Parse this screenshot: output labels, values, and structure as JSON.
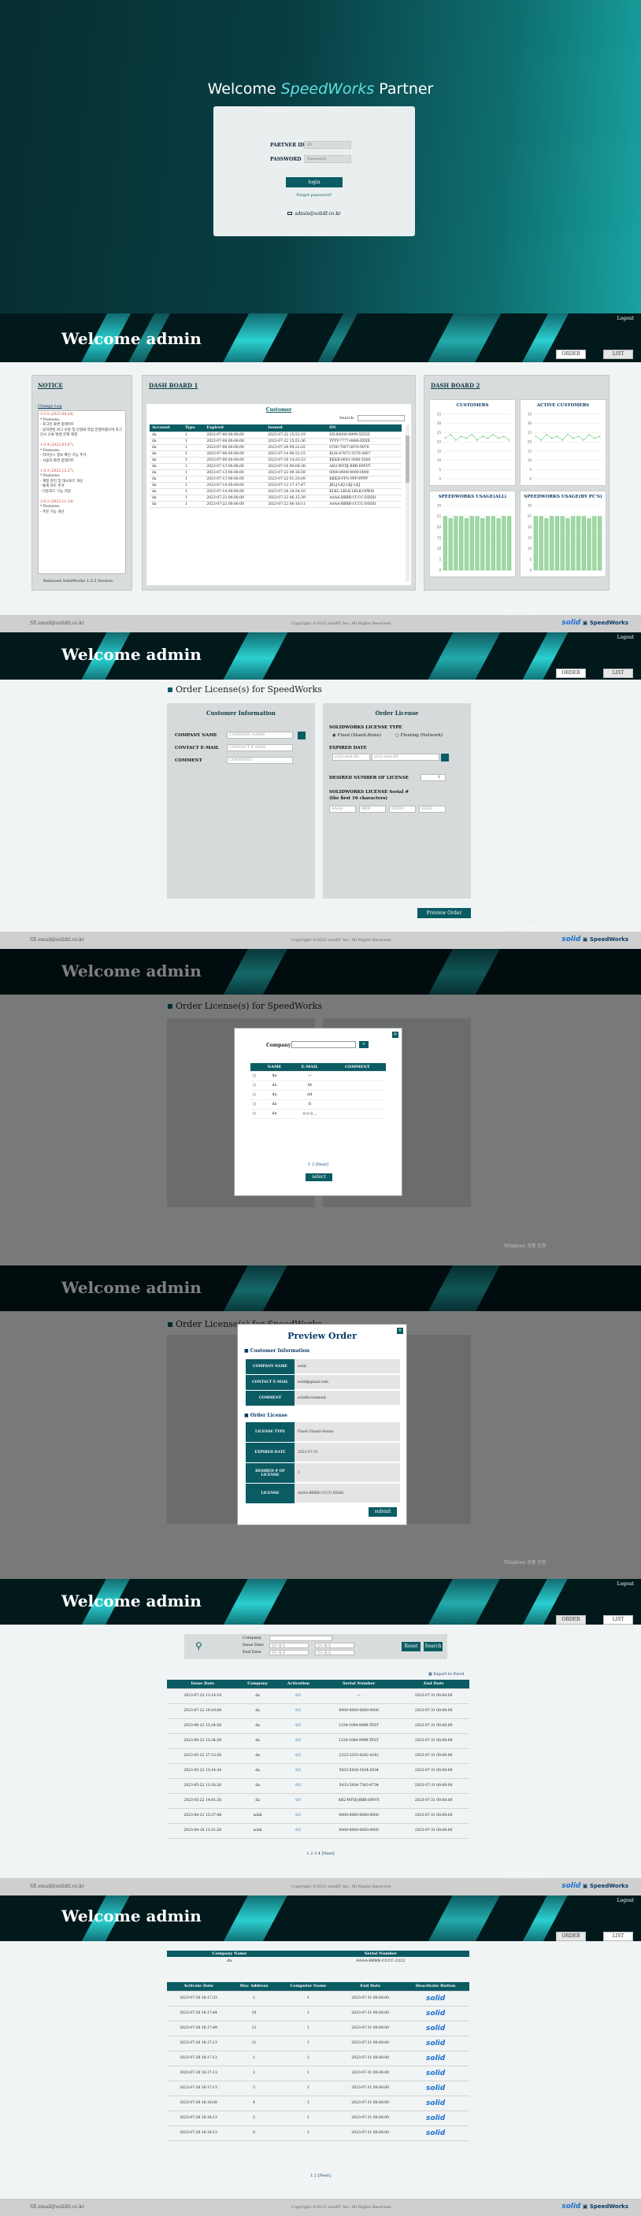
{
  "brand": {
    "accent": "#0b5b63",
    "teal_light": "#5ee0de"
  },
  "login": {
    "welcome_prefix": "Welcome ",
    "welcome_brand": "SpeedWorks",
    "welcome_suffix": " Partner",
    "partner_id_label": "PARTNER ID",
    "partner_id_value": "ID",
    "password_label": "PASSWORD",
    "password_placeholder": "Password",
    "login_button": "login",
    "forgot": "Forgot password?",
    "email_icon": "mail-icon",
    "email": "admin@solidf.co.kr"
  },
  "header": {
    "welcome": "Welcome admin",
    "logout": "Logout",
    "tab_order": "ORDER",
    "tab_list": "LIST"
  },
  "footer": {
    "email": "SE.email@solidit.co.kr",
    "copyright": "Copyright ©2022 solidIT Inc. All Rights Reserved.",
    "brand": "SpeedWorks",
    "logo": "solidit"
  },
  "windows_wm": {
    "line1": "Windows 정품 인증",
    "line2": "설정으로 이동하여 Windows를 정품 인증합니다."
  },
  "dashboard": {
    "notice": {
      "title": "NOTICE",
      "change_log": "Change Log",
      "lines": [
        "1.0.5 (2023.04.24)",
        "* Features:",
        "- 로그인 화면 업데이트",
        "- 동작관련 버그 수정 및 안정화 작업 진행하였으며 로그인시 오류 발생 문제 해결",
        "",
        "1.0.4 (2023.03.07)",
        "* Features:",
        "- 라이선스 정보 확인 기능 추가",
        "- 사용자 화면 업데이트",
        "",
        "1.0.3 (2022.12.27)",
        "* Features:",
        "- 계정 관리 및 대시보드 개선",
        "- 통계 차트 추가",
        "- 다운로드 기능 지원",
        "",
        "1.0.2 (2022.11.14)",
        "* Features:",
        "- 주문 기능 개선"
      ],
      "release": "Released SolidWorks 1.0.5 Version"
    },
    "board1": {
      "title": "DASH BOARD 1",
      "customer": "Customer",
      "search_label": "Search:",
      "columns": [
        "Account",
        "Type",
        "Expired",
        "Issued",
        "SN"
      ],
      "rows": [
        [
          "da",
          "1",
          "2023-07-08 00:00:00",
          "2023-07-22 15:51:19",
          "SD-00000-9999-55555"
        ],
        [
          "da",
          "1",
          "2023-07-08 00:00:00",
          "2023-07-22 15:51:36",
          "YYYY-7777-8888-XXXX"
        ],
        [
          "da",
          "1",
          "2023-07-08 00:00:00",
          "2023-07-28 09:22:02",
          "0700-7007-0070-9978"
        ],
        [
          "da",
          "1",
          "2023-07-08 00:00:00",
          "2023-07-14 06:52:15",
          "KLH-A7871-5376-5667"
        ],
        [
          "da",
          "1",
          "2023-07-08 00:00:00",
          "2023-07-18 14:33:53",
          "KKKK-0003-3000-5500"
        ],
        [
          "da",
          "1",
          "2023-07-13 00:00:00",
          "2023-07-16 00:06:38",
          "AH2-WFDJ-BBB-HWVY"
        ],
        [
          "da",
          "1",
          "2023-07-13 00:00:00",
          "2023-07-22 09:16:58",
          "0000-0000-0000-0000"
        ],
        [
          "da",
          "1",
          "2023-07-13 00:00:00",
          "2023-07-22 01:33:09",
          "KKKH-FPS-PPP-PPPP"
        ],
        [
          "da",
          "1",
          "2023-07-14 00:00:00",
          "2023-07-12 17:17:47",
          "JKLJ-LKJ-LKJ-LKJ"
        ],
        [
          "da",
          "1",
          "2023-07-14 00:00:00",
          "2023-07-28 18:34:10",
          "KLKL-LKLK-LKLK-OPKM"
        ],
        [
          "da",
          "1",
          "2023-07-22 00:00:00",
          "2023-07-22 06:15:39",
          "AAAA-BBBB-CCCC-DDDD"
        ],
        [
          "da",
          "1",
          "2023-07-22 00:00:00",
          "2023-07-22 06:16:11",
          "AAAA-BBBB-CCCC-DDDD"
        ]
      ]
    },
    "board2": {
      "title": "DASH BOARD 2"
    }
  },
  "order": {
    "heading": "Order License(s) for SpeedWorks",
    "customer_info": "Customer Information",
    "company_name": "COMPANY NAME",
    "company_placeholder": "COMPANY NAME",
    "contact_email": "CONTACT E-MAIL",
    "contact_placeholder": "CONTACT E-MAIL",
    "comment": "COMMENT",
    "comment_placeholder": "COMMENT",
    "order_license": "Order License",
    "license_type": "SOLIDWORKS LICENSE TYPE",
    "fixed": "Fixed (Stand-Alone)",
    "floating": "Floating (Network)",
    "expired_date": "EXPIRED DATE",
    "date_placeholder": "yyyy-mm-dd",
    "desired": "DESIRED NUMBER OF LICENSE",
    "desired_value": "1",
    "serial_label": "SOLIDWORKS LICENSE Serial #",
    "serial_hint": "(the first 16 characters)",
    "serial_placeholders": [
      "AAAA",
      "BBB",
      "DDDD",
      "EEEE"
    ],
    "preview_button": "Preview Order"
  },
  "company_modal": {
    "company_label": "Company",
    "columns": [
      "NAME",
      "E-MAIL",
      "COMMENT"
    ],
    "rows": [
      [
        "da",
        "---",
        ""
      ],
      [
        "da",
        "fd",
        ""
      ],
      [
        "da",
        "dd",
        ""
      ],
      [
        "da",
        "fl",
        ""
      ],
      [
        "da",
        "ㅇㅇㅇ...",
        ""
      ]
    ],
    "pager": "1 2 [Next]",
    "select": "select"
  },
  "preview_modal": {
    "title": "Preview Order",
    "customer_info": "Customer Information",
    "rows1": [
      [
        "COMPANY NAME",
        "solid"
      ],
      [
        "CONTACT E-MAIL",
        "solid@gmail.com"
      ],
      [
        "COMMENT",
        "solid&comment"
      ]
    ],
    "order_license": "Order License",
    "rows2": [
      [
        "LICENSE TYPE",
        "Fixed (Stand-Alone)"
      ],
      [
        "EXPIRED DATE",
        "2023-07-31"
      ],
      [
        "DESIRED # OF LICENSE",
        "1"
      ],
      [
        "LICENSE",
        "AAAA-BBBB-CCCC-DDAE"
      ]
    ],
    "submit": "submit",
    "bg_serial": "DDAE",
    "bg_valid": "Valid"
  },
  "list": {
    "company_label": "Company",
    "issue_label": "Issue Date",
    "end_label": "End Date",
    "date_placeholder": "연도-월-일",
    "reset": "Reset",
    "search": "Search",
    "export": "Export to Excel",
    "columns": [
      "Issue Date",
      "Company",
      "Activation",
      "Serial Number",
      "End Date"
    ],
    "rows": [
      [
        "2023-07-23 11:14:18",
        "da",
        "0/1",
        "---",
        "2023-07-31 00:00:00"
      ],
      [
        "2023-07-22 10:19:08",
        "da",
        "0/1",
        "0000-0000-0000-0000",
        "2023-07-31 00:00:00"
      ],
      [
        "2023-06-22 13:34:58",
        "da",
        "0/1",
        "1234-1084-8888-TEST",
        "2023-07-31 00:00:00"
      ],
      [
        "2023-06-22 13:34:58",
        "da",
        "0/1",
        "1234-1084-9999-TEST",
        "2023-07-31 00:00:00"
      ],
      [
        "2023-05-22 17:13:58",
        "da",
        "0/1",
        "2323-3333-4242-4242",
        "2023-07-31 00:00:00"
      ],
      [
        "2023-05-22 13:14:34",
        "da",
        "0/1",
        "5433-5434-5434-5434",
        "2023-07-31 00:00:00"
      ],
      [
        "2023-05-22 11:16:26",
        "da",
        "0/1",
        "5433-5434-7343-4734",
        "2023-07-31 00:00:00"
      ],
      [
        "2023-05-22 14:01:26",
        "da",
        "0/1",
        "AH2-WFDJ-BBB-HWVY",
        "2023-07-31 00:00:00"
      ],
      [
        "2023-04-22 13:37:48",
        "solid",
        "0/1",
        "0000-0000-0000-0000",
        "2023-07-31 00:00:00"
      ],
      [
        "2023-04-18 13:21:28",
        "solid",
        "0/1",
        "0000-0000-0000-0000",
        "2023-07-31 00:00:00"
      ]
    ],
    "pager": "1 2 3 4 [Next]"
  },
  "detail": {
    "h_company": "Company Name",
    "h_serial": "Serial Number",
    "company": "da",
    "serial": "AAAA-BBBB-CCCC-2222",
    "columns": [
      "Activate Date",
      "Mac Address",
      "Computer Name",
      "End Date",
      "Deactivate Button"
    ],
    "rows": [
      [
        "2023-07-28 18:17:33",
        "2",
        "1",
        "2023-07-31 00:00:00"
      ],
      [
        "2023-07-28 18:17:44",
        "10",
        "1",
        "2023-07-31 00:00:00"
      ],
      [
        "2023-07-28 18:17:49",
        "12",
        "1",
        "2023-07-31 00:00:00"
      ],
      [
        "2023-07-28 18:17:13",
        "11",
        "1",
        "2023-07-31 00:00:00"
      ],
      [
        "2023-07-28 18:17:13",
        "1",
        "1",
        "2023-07-31 00:00:00"
      ],
      [
        "2023-07-28 18:17:13",
        "2",
        "1",
        "2023-07-31 00:00:00"
      ],
      [
        "2023-07-28 18:17:13",
        "3",
        "1",
        "2023-07-31 00:00:00"
      ],
      [
        "2023-07-28 18:18:08",
        "4",
        "1",
        "2023-07-31 00:00:00"
      ],
      [
        "2023-07-28 18:18:13",
        "5",
        "1",
        "2023-07-31 00:00:00"
      ],
      [
        "2023-07-28 18:18:13",
        "8",
        "1",
        "2023-07-31 00:00:00"
      ]
    ],
    "deactivate_logo": "solid",
    "pager": "1 2 [Next]"
  },
  "chart_data": [
    {
      "type": "line",
      "title": "CUSTOMERS",
      "ylim": [
        0,
        35
      ],
      "yticks": [
        "35",
        "30",
        "25",
        "20",
        "15",
        "10",
        "5",
        "0"
      ],
      "series": [
        {
          "values": [
            22,
            24,
            21,
            23,
            22,
            24,
            21,
            23,
            22,
            24,
            22,
            23,
            21
          ]
        }
      ]
    },
    {
      "type": "line",
      "title": "ACTIVE CUSTOMERS",
      "ylim": [
        0,
        35
      ],
      "yticks": [
        "35",
        "30",
        "25",
        "20",
        "15",
        "10",
        "5",
        "0"
      ],
      "series": [
        {
          "values": [
            23,
            21,
            24,
            22,
            23,
            21,
            24,
            22,
            23,
            21,
            24,
            22,
            23
          ]
        }
      ]
    },
    {
      "type": "bar",
      "title": "SPEEDWORKS USAGE(ALL)",
      "ylim": [
        0,
        30
      ],
      "yticks": [
        "30",
        "25",
        "20",
        "15",
        "10",
        "5",
        "0"
      ],
      "series": [
        {
          "values": [
            25,
            24,
            25,
            25,
            24,
            25,
            25,
            24,
            25,
            25,
            24,
            25,
            25
          ]
        }
      ]
    },
    {
      "type": "bar",
      "title": "SPEEDWORKS USAGE(BY PC'S)",
      "ylim": [
        0,
        30
      ],
      "yticks": [
        "30",
        "25",
        "20",
        "15",
        "10",
        "5",
        "0"
      ],
      "series": [
        {
          "values": [
            25,
            25,
            24,
            25,
            25,
            25,
            24,
            25,
            25,
            25,
            24,
            25,
            25
          ]
        }
      ]
    }
  ]
}
